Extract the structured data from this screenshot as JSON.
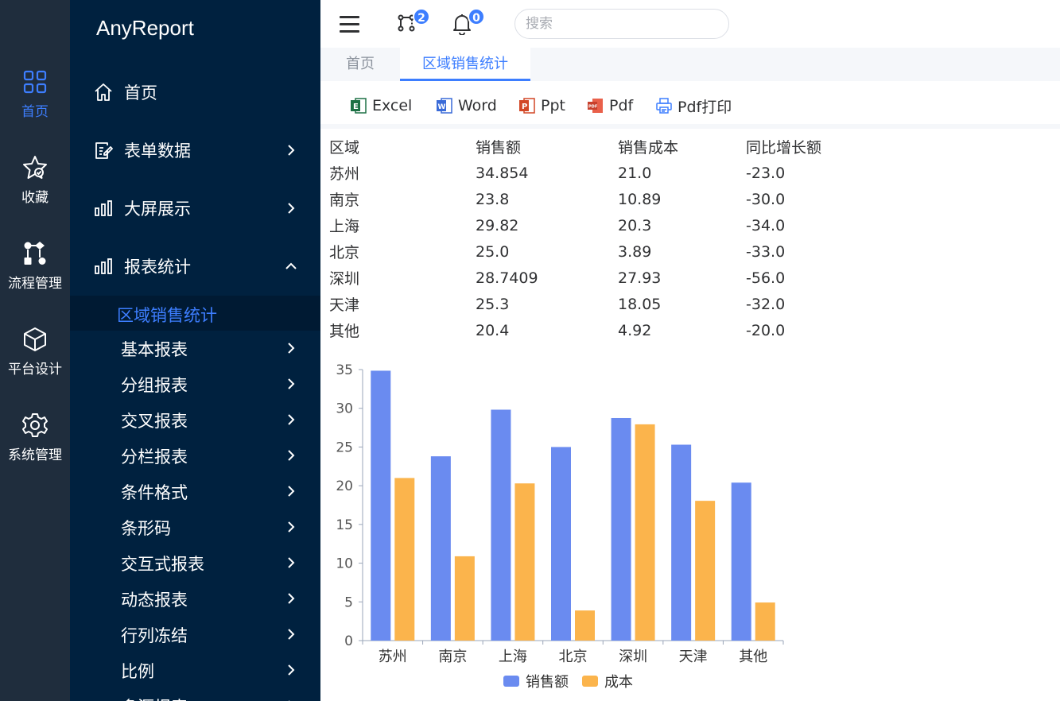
{
  "rail": {
    "items": [
      {
        "label": "首页",
        "icon": "grid-icon",
        "active": true
      },
      {
        "label": "收藏",
        "icon": "star-check-icon"
      },
      {
        "label": "流程管理",
        "icon": "workflow-icon"
      },
      {
        "label": "平台设计",
        "icon": "cube-icon"
      },
      {
        "label": "系统管理",
        "icon": "gear-icon"
      }
    ]
  },
  "menu": {
    "brand": "AnyReport",
    "items": [
      {
        "label": "首页",
        "icon": "home-icon"
      },
      {
        "label": "表单数据",
        "icon": "form-edit-icon"
      },
      {
        "label": "大屏展示",
        "icon": "bar-chart-icon"
      },
      {
        "label": "报表统计",
        "icon": "bar-chart-icon",
        "expanded": true
      }
    ],
    "active_sub": "区域销售统计",
    "sub_items": [
      "基本报表",
      "分组报表",
      "交叉报表",
      "分栏报表",
      "条件格式",
      "条形码",
      "交互式报表",
      "动态报表",
      "行列冻结",
      "比例",
      "多源报表"
    ]
  },
  "header": {
    "workflow_badge": "2",
    "notification_badge": "0",
    "search_placeholder": "搜索"
  },
  "tabs": [
    {
      "label": "首页",
      "active": false
    },
    {
      "label": "区域销售统计",
      "active": true
    }
  ],
  "toolbar": {
    "excel": "Excel",
    "word": "Word",
    "ppt": "Ppt",
    "pdf": "Pdf",
    "pdf_print": "Pdf打印"
  },
  "colors": {
    "accent": "#3d7eff",
    "sales_series": "#6a8bf0",
    "cost_series": "#fbb44c",
    "menu_bg": "#00213f",
    "rail_bg": "#1f2d3d"
  },
  "table": {
    "headers": [
      "区域",
      "销售额",
      "销售成本",
      "同比增长额"
    ],
    "rows": [
      [
        "苏州",
        "34.854",
        "21.0",
        "-23.0"
      ],
      [
        "南京",
        "23.8",
        "10.89",
        "-30.0"
      ],
      [
        "上海",
        "29.82",
        "20.3",
        "-34.0"
      ],
      [
        "北京",
        "25.0",
        "3.89",
        "-33.0"
      ],
      [
        "深圳",
        "28.7409",
        "27.93",
        "-56.0"
      ],
      [
        "天津",
        "25.3",
        "18.05",
        "-32.0"
      ],
      [
        "其他",
        "20.4",
        "4.92",
        "-20.0"
      ]
    ]
  },
  "chart_data": {
    "type": "bar",
    "categories": [
      "苏州",
      "南京",
      "上海",
      "北京",
      "深圳",
      "天津",
      "其他"
    ],
    "series": [
      {
        "name": "销售额",
        "values": [
          34.854,
          23.8,
          29.82,
          25.0,
          28.7409,
          25.3,
          20.4
        ]
      },
      {
        "name": "成本",
        "values": [
          21.0,
          10.89,
          20.3,
          3.89,
          27.93,
          18.05,
          4.92
        ]
      }
    ],
    "ylim": [
      0,
      35
    ],
    "yticks": [
      0,
      5,
      10,
      15,
      20,
      25,
      30,
      35
    ],
    "legend": "bottom-center",
    "grid": false
  }
}
